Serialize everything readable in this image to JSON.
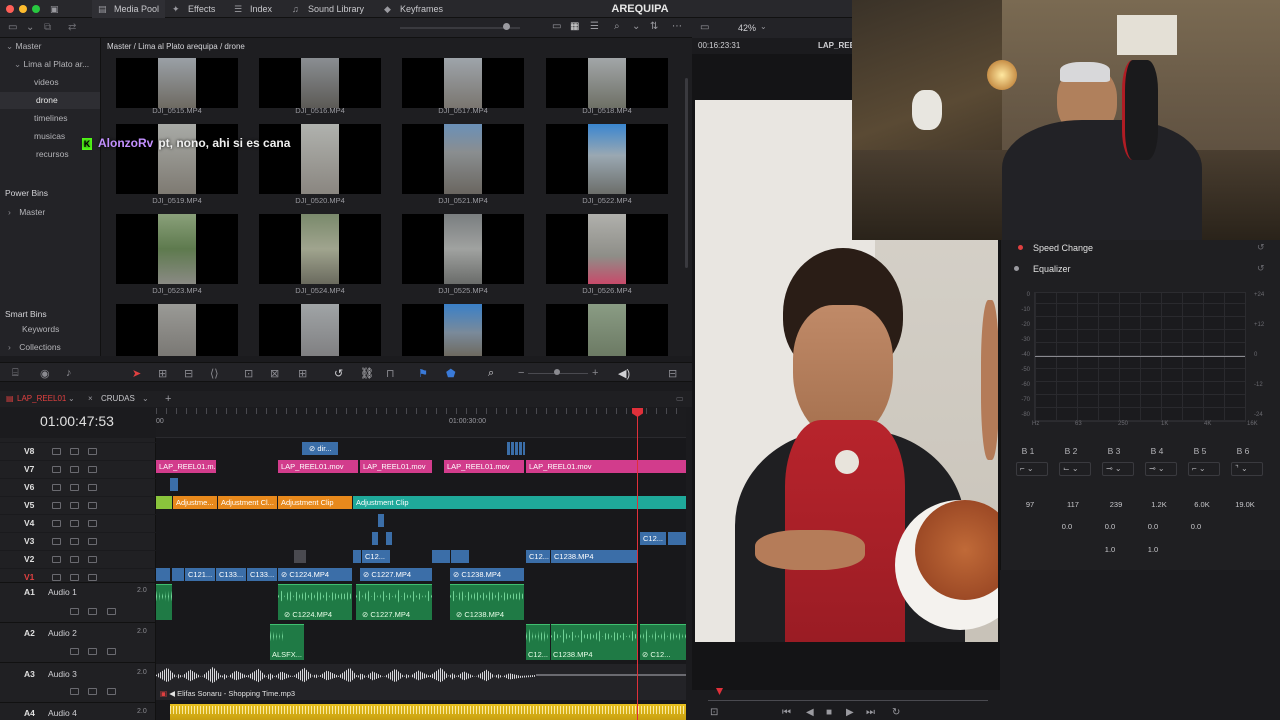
{
  "app": {
    "title": "AREQUIPA",
    "tabs": [
      "Media Pool",
      "Effects",
      "Index",
      "Sound Library",
      "Keyframes"
    ],
    "zoom": "42%",
    "viewer_timecode": "00:16:23:31",
    "viewer_clip": "LAP_REEL"
  },
  "sidebar": {
    "master": "Master",
    "items": [
      "Lima al Plato ar...",
      "videos",
      "drone",
      "timelines",
      "musicas",
      "recursos"
    ],
    "power_bins": "Power Bins",
    "power_master": "Master",
    "smart_bins": "Smart Bins",
    "keywords": "Keywords",
    "collections": "Collections"
  },
  "pool": {
    "breadcrumb": "Master / Lima al Plato arequipa / drone",
    "rows": [
      [
        "DJI_0515.MP4",
        "DJI_0516.MP4",
        "DJI_0517.MP4",
        "DJI_0518.MP4"
      ],
      [
        "DJI_0519.MP4",
        "DJI_0520.MP4",
        "DJI_0521.MP4",
        "DJI_0522.MP4"
      ],
      [
        "DJI_0523.MP4",
        "DJI_0524.MP4",
        "DJI_0525.MP4",
        "DJI_0526.MP4"
      ]
    ]
  },
  "chat": {
    "user": "AlonzoRv",
    "message": "pt, nono, ahi si es cana",
    "badge": "K"
  },
  "timeline": {
    "tab1": "LAP_REEL01",
    "tab2": "CRUDAS",
    "timecode": "01:00:47:53",
    "ruler_start": "00",
    "ruler_mid": "01:00:30:00",
    "video_tracks": [
      "V8",
      "V7",
      "V6",
      "V5",
      "V4",
      "V3",
      "V2",
      "V1"
    ],
    "audio_tracks": [
      {
        "id": "A1",
        "name": "Audio 1",
        "vol": "2.0"
      },
      {
        "id": "A2",
        "name": "Audio 2",
        "vol": "2.0"
      },
      {
        "id": "A3",
        "name": "Audio 3",
        "vol": "2.0"
      },
      {
        "id": "A4",
        "name": "Audio 4",
        "vol": "2.0"
      }
    ],
    "clips": {
      "v8_dir": "dir...",
      "v7": [
        "LAP_REEL01.m...",
        "LAP_REEL01.mov",
        "LAP_REEL01.mov",
        "LAP_REEL01.mov",
        "LAP_REEL01.mov"
      ],
      "v5": [
        "Adjustme...",
        "Adjustment Cl...",
        "Adjustment Clip",
        "Adjustment Clip"
      ],
      "v3": "C12...",
      "v2": [
        "C12...",
        "C12...",
        "C1238.MP4"
      ],
      "v1": [
        "C121...",
        "C133...",
        "C133...",
        "C1224.MP4",
        "C1227.MP4",
        "C1238.MP4"
      ],
      "a1": [
        "C1224.MP4",
        "C1227.MP4",
        "C1238.MP4"
      ],
      "a2": [
        "ALSFX...",
        "C12...",
        "C1238.MP4",
        "C12..."
      ],
      "a3": "Elifas Sonaru - Shopping Time.mp3"
    }
  },
  "inspector": {
    "speed_change": "Speed Change",
    "equalizer": "Equalizer",
    "db_scale": [
      "+24",
      "+12",
      "0",
      "-12",
      "-24"
    ],
    "db_left": [
      "0",
      "-10",
      "-20",
      "-30",
      "-40",
      "-50",
      "-60",
      "-70",
      "-80"
    ],
    "freq_scale": [
      "Hz",
      "63",
      "250",
      "1K",
      "4K",
      "16K"
    ],
    "bands": [
      "B 1",
      "B 2",
      "B 3",
      "B 4",
      "B 5",
      "B 6"
    ],
    "freq": [
      "97",
      "117",
      "239",
      "1.2K",
      "6.0K",
      "19.0K"
    ],
    "gain": [
      "0.0",
      "0.0",
      "0.0",
      "0.0"
    ],
    "q": [
      "1.0",
      "1.0"
    ]
  },
  "colors": {
    "v7_clip": "#d23c8c",
    "v5_clip": "#e8891c",
    "v5_teal": "#1fa99a",
    "v1_clip": "#3b6ea8",
    "audio_clip": "#1f7a45",
    "playhead": "#e0303a"
  }
}
